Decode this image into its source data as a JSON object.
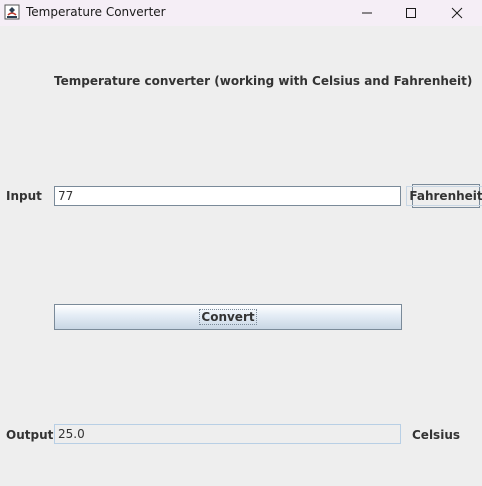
{
  "window": {
    "title": "Temperature Converter",
    "app_icon": "java-icon",
    "controls": [
      "minimize-icon",
      "maximize-icon",
      "close-icon"
    ]
  },
  "main": {
    "heading": "Temperature converter (working with Celsius and Fahrenheit)",
    "input_label": "Input",
    "input_value": "77",
    "unit_button_label": "Fahrenheit",
    "convert_button_label": "Convert",
    "output_label": "Output",
    "output_value": "25.0",
    "output_unit": "Celsius"
  }
}
